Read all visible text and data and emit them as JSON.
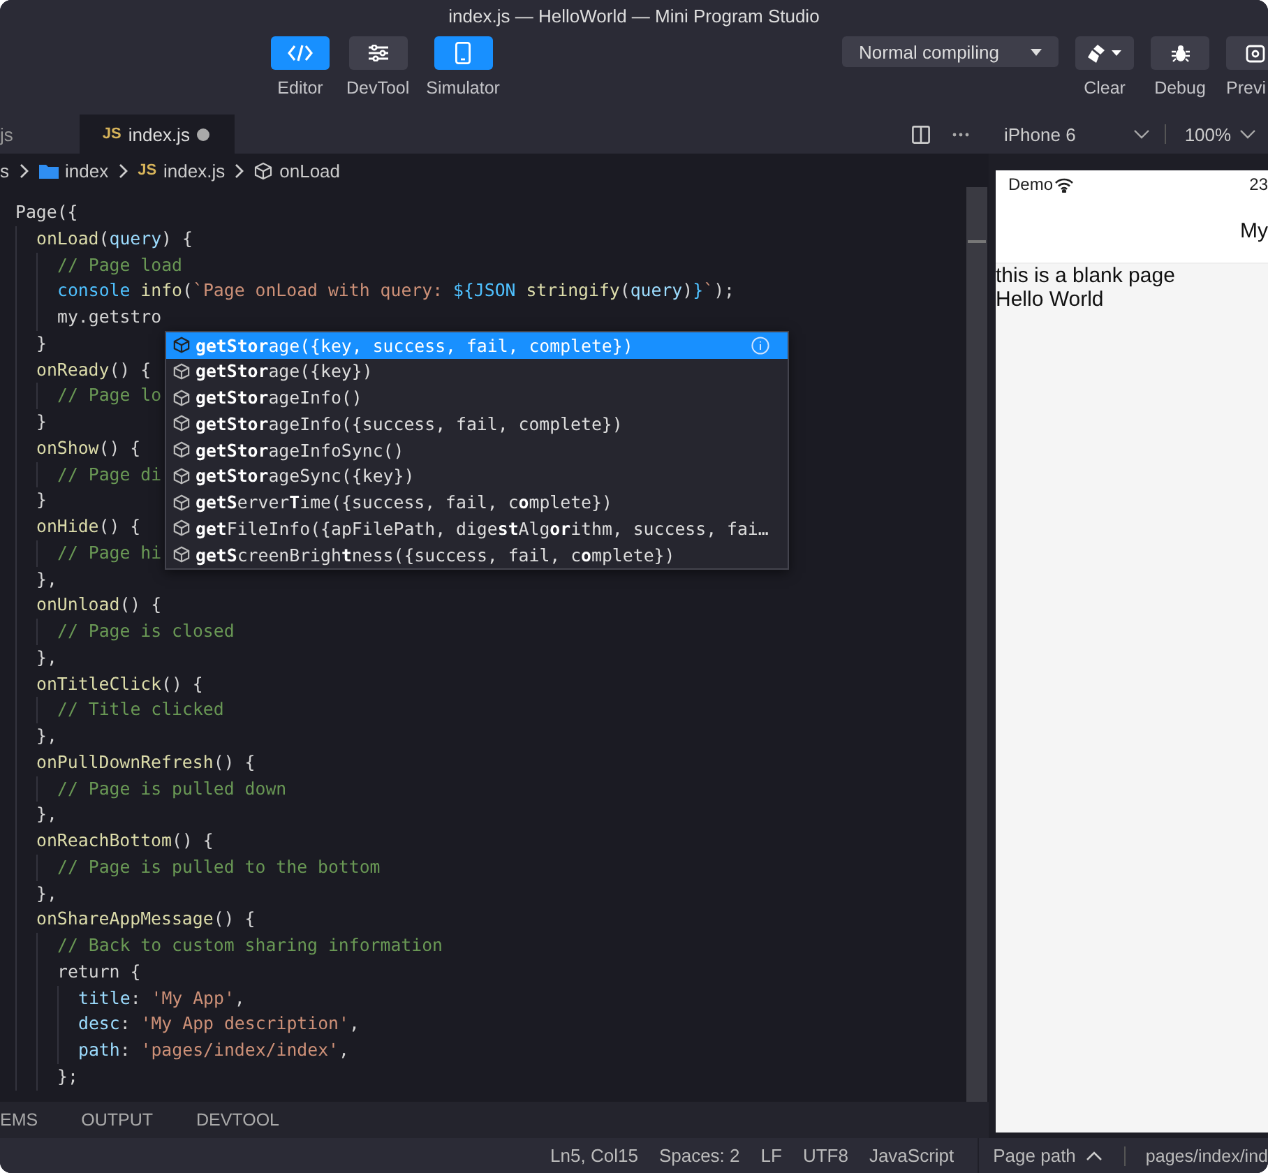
{
  "window": {
    "title": "index.js — HelloWorld — Mini Program Studio"
  },
  "toolbar": {
    "left": [
      {
        "label": "Editor",
        "selected": true
      },
      {
        "label": "DevTool",
        "selected": false
      },
      {
        "label": "Simulator",
        "selected": true
      }
    ],
    "compile": "Normal compiling",
    "right": [
      {
        "label": "Clear",
        "caret": true
      },
      {
        "label": "Debug",
        "caret": false
      },
      {
        "label": "Previ",
        "caret": false
      }
    ]
  },
  "tabs": [
    {
      "label": "js",
      "selected": false,
      "modified": false
    },
    {
      "badge": "JS",
      "label": "index.js",
      "selected": true,
      "modified": true
    }
  ],
  "device": {
    "model": "iPhone 6",
    "zoom": "100%"
  },
  "breadcrumb": [
    {
      "label": "s"
    },
    {
      "label": "index"
    },
    {
      "badge": "JS",
      "label": "index.js"
    },
    {
      "label": "onLoad"
    }
  ],
  "code": [
    {
      "tokens": [
        {
          "kind": "plain",
          "text": "Page({"
        }
      ],
      "children": [
        {
          "tokens": [
            {
              "kind": "fn",
              "text": "onLoad"
            },
            {
              "kind": "plain",
              "text": "("
            },
            {
              "kind": "var",
              "text": "query"
            },
            {
              "kind": "plain",
              "text": ") {"
            }
          ],
          "children": [
            {
              "tokens": [
                {
                  "kind": "comment",
                  "text": "// Page load"
                }
              ]
            },
            {
              "tokens": [
                {
                  "kind": "const",
                  "text": "console"
                },
                {
                  "kind": "fn",
                  "text": " info"
                },
                {
                  "kind": "plain",
                  "text": "("
                },
                {
                  "kind": "str",
                  "text": "`Page onLoad with query: "
                },
                {
                  "kind": "const",
                  "text": "${JSON"
                },
                {
                  "kind": "fn",
                  "text": " stringify"
                },
                {
                  "kind": "plain",
                  "text": "("
                },
                {
                  "kind": "var",
                  "text": "query"
                },
                {
                  "kind": "plain",
                  "text": ")"
                },
                {
                  "kind": "const",
                  "text": "}"
                },
                {
                  "kind": "str",
                  "text": "`"
                },
                {
                  "kind": "plain",
                  "text": ");"
                }
              ]
            },
            {
              "tokens": [
                {
                  "kind": "plain",
                  "text": "my.getstro"
                }
              ]
            }
          ]
        },
        {
          "tokens": [
            {
              "kind": "plain",
              "text": "}"
            }
          ]
        },
        {
          "tokens": [
            {
              "kind": "fn",
              "text": "onReady"
            },
            {
              "kind": "plain",
              "text": "() {"
            }
          ],
          "children": [
            {
              "tokens": [
                {
                  "kind": "comment",
                  "text": "// Page lo"
                }
              ]
            }
          ]
        },
        {
          "tokens": [
            {
              "kind": "plain",
              "text": "}"
            }
          ]
        },
        {
          "tokens": [
            {
              "kind": "fn",
              "text": "onShow"
            },
            {
              "kind": "plain",
              "text": "() {"
            }
          ],
          "children": [
            {
              "tokens": [
                {
                  "kind": "comment",
                  "text": "// Page di"
                }
              ]
            }
          ]
        },
        {
          "tokens": [
            {
              "kind": "plain",
              "text": "}"
            }
          ]
        },
        {
          "tokens": [
            {
              "kind": "fn",
              "text": "onHide"
            },
            {
              "kind": "plain",
              "text": "() {"
            }
          ],
          "children": [
            {
              "tokens": [
                {
                  "kind": "comment",
                  "text": "// Page hi"
                }
              ]
            }
          ]
        },
        {
          "tokens": [
            {
              "kind": "plain",
              "text": "},"
            }
          ]
        },
        {
          "tokens": [
            {
              "kind": "fn",
              "text": "onUnload"
            },
            {
              "kind": "plain",
              "text": "() {"
            }
          ],
          "children": [
            {
              "tokens": [
                {
                  "kind": "comment",
                  "text": "// Page is closed"
                }
              ]
            }
          ]
        },
        {
          "tokens": [
            {
              "kind": "plain",
              "text": "},"
            }
          ]
        },
        {
          "tokens": [
            {
              "kind": "fn",
              "text": "onTitleClick"
            },
            {
              "kind": "plain",
              "text": "() {"
            }
          ],
          "children": [
            {
              "tokens": [
                {
                  "kind": "comment",
                  "text": "// Title clicked"
                }
              ]
            }
          ]
        },
        {
          "tokens": [
            {
              "kind": "plain",
              "text": "},"
            }
          ]
        },
        {
          "tokens": [
            {
              "kind": "fn",
              "text": "onPullDownRefresh"
            },
            {
              "kind": "plain",
              "text": "() {"
            }
          ],
          "children": [
            {
              "tokens": [
                {
                  "kind": "comment",
                  "text": "// Page is pulled down"
                }
              ]
            }
          ]
        },
        {
          "tokens": [
            {
              "kind": "plain",
              "text": "},"
            }
          ]
        },
        {
          "tokens": [
            {
              "kind": "fn",
              "text": "onReachBottom"
            },
            {
              "kind": "plain",
              "text": "() {"
            }
          ],
          "children": [
            {
              "tokens": [
                {
                  "kind": "comment",
                  "text": "// Page is pulled to the bottom"
                }
              ]
            }
          ]
        },
        {
          "tokens": [
            {
              "kind": "plain",
              "text": "},"
            }
          ]
        },
        {
          "tokens": [
            {
              "kind": "fn",
              "text": "onShareAppMessage"
            },
            {
              "kind": "plain",
              "text": "() {"
            }
          ],
          "children": [
            {
              "tokens": [
                {
                  "kind": "comment",
                  "text": "// Back to custom sharing information"
                }
              ]
            },
            {
              "tokens": [
                {
                  "kind": "plain",
                  "text": "return {"
                }
              ],
              "children": [
                {
                  "tokens": [
                    {
                      "kind": "var",
                      "text": "title"
                    },
                    {
                      "kind": "plain",
                      "text": ": "
                    },
                    {
                      "kind": "str",
                      "text": "'My App'"
                    },
                    {
                      "kind": "plain",
                      "text": ","
                    }
                  ]
                },
                {
                  "tokens": [
                    {
                      "kind": "var",
                      "text": "desc"
                    },
                    {
                      "kind": "plain",
                      "text": ": "
                    },
                    {
                      "kind": "str",
                      "text": "'My App description'"
                    },
                    {
                      "kind": "plain",
                      "text": ","
                    }
                  ]
                },
                {
                  "tokens": [
                    {
                      "kind": "var",
                      "text": "path"
                    },
                    {
                      "kind": "plain",
                      "text": ": "
                    },
                    {
                      "kind": "str",
                      "text": "'pages/index/index'"
                    },
                    {
                      "kind": "plain",
                      "text": ","
                    }
                  ]
                }
              ]
            },
            {
              "tokens": [
                {
                  "kind": "plain",
                  "text": "};"
                }
              ]
            }
          ]
        }
      ]
    }
  ],
  "suggestions": [
    {
      "text": "**getStor**age({key, success, fail, complete})",
      "selected": true
    },
    {
      "text": "**getStor**age({key})",
      "selected": false
    },
    {
      "text": "**getStor**ageInfo()",
      "selected": false
    },
    {
      "text": "**getStor**ageInfo({success, fail, complete})",
      "selected": false
    },
    {
      "text": "**getStor**ageInfoSync()",
      "selected": false
    },
    {
      "text": "**getStor**ageSync({key})",
      "selected": false
    },
    {
      "text": "**getS**erver**T**ime({success, fail, c**o**mplete})",
      "selected": false
    },
    {
      "text": "**get**FileInfo({apFilePath, dige**st**Alg**or**ithm, success, fai…",
      "selected": false
    },
    {
      "text": "**getS**creenBrigh**t**ness({success, fail, c**o**mplete})",
      "selected": false
    }
  ],
  "simulator": {
    "carrier": "Demo",
    "time": "23",
    "nav_title": "My",
    "lines": [
      "this is a blank page",
      "Hello World"
    ]
  },
  "panel_tabs": [
    "EMS",
    "OUTPUT",
    "DEVTOOL"
  ],
  "status_bar": {
    "items": [
      "Ln5, Col15",
      "Spaces: 2",
      "LF",
      "UTF8",
      "JavaScript"
    ],
    "page_path": "Page path",
    "path": "pages/index/ind"
  }
}
